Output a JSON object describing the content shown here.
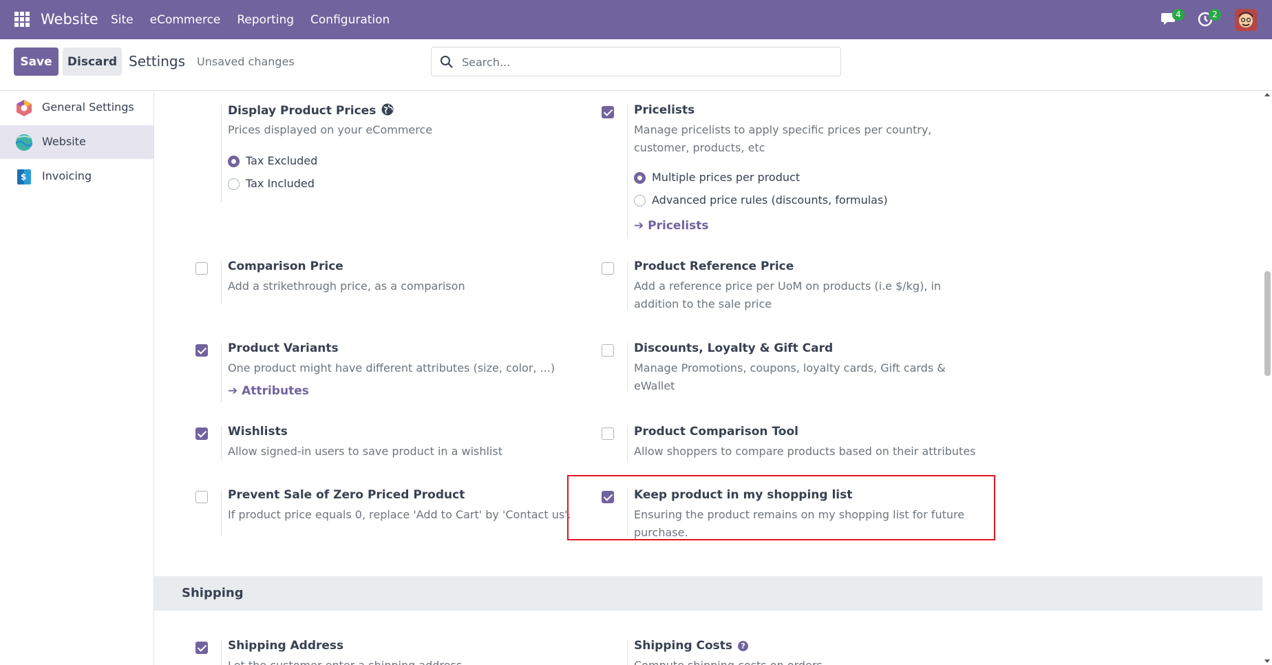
{
  "navbar": {
    "brand": "Website",
    "menu": [
      "Site",
      "eCommerce",
      "Reporting",
      "Configuration"
    ],
    "chat_count": "4",
    "activity_count": "2",
    "bg_color": "#71639e"
  },
  "control": {
    "save_label": "Save",
    "discard_label": "Discard",
    "title": "Settings",
    "status": "Unsaved changes",
    "search_placeholder": "Search..."
  },
  "sidebar": {
    "items": [
      {
        "label": "General Settings",
        "icon": "odoo-icon"
      },
      {
        "label": "Website",
        "icon": "website-icon",
        "active": true
      },
      {
        "label": "Invoicing",
        "icon": "invoicing-icon"
      }
    ]
  },
  "settings": {
    "display_prices": {
      "title": "Display Product Prices",
      "desc": "Prices displayed on your eCommerce",
      "options": [
        "Tax Excluded",
        "Tax Included"
      ],
      "selected": 0
    },
    "pricelists": {
      "title": "Pricelists",
      "desc": "Manage pricelists to apply specific prices per country, customer, products, etc",
      "checked": true,
      "options": [
        "Multiple prices per product",
        "Advanced price rules (discounts, formulas)"
      ],
      "selected": 0,
      "link": "Pricelists"
    },
    "comparison_price": {
      "title": "Comparison Price",
      "desc": "Add a strikethrough price, as a comparison",
      "checked": false
    },
    "reference_price": {
      "title": "Product Reference Price",
      "desc": "Add a reference price per UoM on products (i.e $/kg), in addition to the sale price",
      "checked": false
    },
    "variants": {
      "title": "Product Variants",
      "desc": "One product might have different attributes (size, color, ...)",
      "checked": true,
      "link": "Attributes"
    },
    "discounts": {
      "title": "Discounts, Loyalty & Gift Card",
      "desc": "Manage Promotions, coupons, loyalty cards, Gift cards & eWallet",
      "checked": false
    },
    "wishlists": {
      "title": "Wishlists",
      "desc": "Allow signed-in users to save product in a wishlist",
      "checked": true
    },
    "comparison_tool": {
      "title": "Product Comparison Tool",
      "desc": "Allow shoppers to compare products based on their attributes",
      "checked": false
    },
    "zero_price": {
      "title": "Prevent Sale of Zero Priced Product",
      "desc": "If product price equals 0, replace 'Add to Cart' by 'Contact us'.",
      "checked": false
    },
    "keep_product": {
      "title": "Keep product in my shopping list",
      "desc": "Ensuring the product remains on my shopping list for future purchase.",
      "checked": true
    },
    "shipping_section": "Shipping",
    "shipping_address": {
      "title": "Shipping Address",
      "desc": "Let the customer enter a shipping address",
      "checked": true
    },
    "shipping_costs": {
      "title": "Shipping Costs",
      "desc": "Compute shipping costs on orders"
    }
  }
}
